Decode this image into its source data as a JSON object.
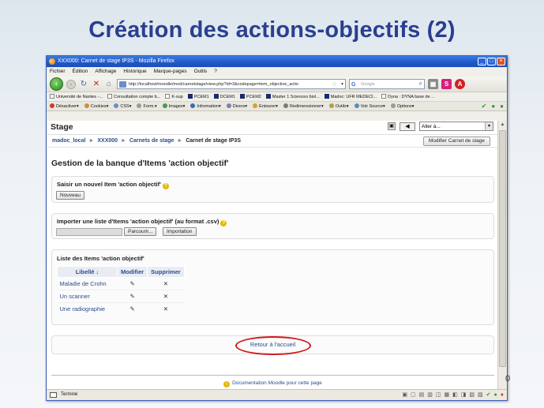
{
  "slide": {
    "title": "Création des actions-objectifs (2)",
    "page_number": "0"
  },
  "browser": {
    "window_title": "XXX000: Carnet de stage IP3S - Mozilla Firefox",
    "menu": [
      "Fichier",
      "Édition",
      "Affichage",
      "Historique",
      "Marque-pages",
      "Outils",
      "?"
    ],
    "url": "http://localhost/moodle/mod/carnetstage/view.php?id=3&codepage=item_objective_actio",
    "search_placeholder": "Google",
    "bookmarks": [
      "Université de Nantes -...",
      "Consultation compte b...",
      "K-sup",
      "PCEM1",
      "DCEM1",
      "PCEM2",
      "Master 1 Sciences biol...",
      "Madoc: UFR MEDECI...",
      "Dyna : DYNA base de ..."
    ],
    "devbar": [
      "Désactiver",
      "Cookies",
      "CSS",
      "Form.",
      "Images",
      "Information",
      "Divers",
      "Entourer",
      "Redimensionner",
      "Outils",
      "Voir Source",
      "Options"
    ],
    "status_text": "Terminé"
  },
  "page": {
    "course_title": "Stage",
    "jump_select_value": "Aller à...",
    "breadcrumb": {
      "items": [
        "madoc_local",
        "XXX000",
        "Carnets de stage"
      ],
      "current": "Carnet de stage IP3S"
    },
    "edit_button": "Modifier Carnet de stage",
    "main_heading": "Gestion de la banque d'Items 'action objectif'",
    "new_item": {
      "label": "Saisir un nouvel Item 'action objectif'",
      "button": "Nouveau"
    },
    "import": {
      "label": "Importer une liste d'Items 'action objectif' (au format .csv)",
      "browse_button": "Parcourir...",
      "import_button": "Importation"
    },
    "list": {
      "label": "Liste des Items 'action objectif'",
      "columns": [
        "Libellé ↓",
        "Modifier",
        "Supprimer"
      ],
      "rows": [
        {
          "name": "Maladie de Crohn"
        },
        {
          "name": "Un scanner"
        },
        {
          "name": "Une radiographie"
        }
      ]
    },
    "back_link": "Retour à l'accueil",
    "footer_doc": "Documentation Moodle pour cette page"
  },
  "colors": {
    "title_blue": "#2a3f8f",
    "link_blue": "#2a4d8f",
    "highlight_red": "#d01919"
  },
  "icons": {
    "edit": "edit-icon",
    "delete": "delete-icon",
    "help": "help-icon"
  }
}
